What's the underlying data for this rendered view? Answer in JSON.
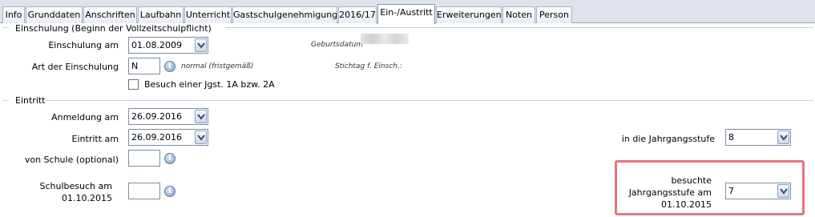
{
  "tabs": [
    {
      "label": "Info",
      "active": false
    },
    {
      "label": "Grunddaten",
      "active": false
    },
    {
      "label": "Anschriften",
      "active": false
    },
    {
      "label": "Laufbahn",
      "active": false
    },
    {
      "label": "Unterricht",
      "active": false
    },
    {
      "label": "Gastschulgenehmigung",
      "active": false
    },
    {
      "label": "2016/17",
      "active": false
    },
    {
      "label": "Ein-/Austritt",
      "active": true
    },
    {
      "label": "Erweiterungen",
      "active": false
    },
    {
      "label": "Noten",
      "active": false
    },
    {
      "label": "Person",
      "active": false
    }
  ],
  "einschulung": {
    "title": "Einschulung (Beginn der Vollzeitschulpflicht)",
    "date_label": "Einschulung am",
    "date_value": "01.08.2009",
    "art_label": "Art der Einschulung",
    "art_value": "N",
    "art_description": "normal (fristgemäß)",
    "geburtsdatum_label": "Geburtsdatum",
    "stichtag_label": "Stichtag f. Einsch.:",
    "checkbox_label": "Besuch einer Jgst. 1A bzw. 2A",
    "checkbox_checked": false
  },
  "eintritt": {
    "title": "Eintritt",
    "anmeldung_label": "Anmeldung am",
    "anmeldung_value": "26.09.2016",
    "eintritt_label": "Eintritt am",
    "eintritt_value": "26.09.2016",
    "von_schule_label": "von Schule (optional)",
    "von_schule_value": "",
    "schulbesuch_label_1": "Schulbesuch am",
    "schulbesuch_label_2": "01.10.2015",
    "schulbesuch_value": "",
    "jahrgangsstufe_label": "in die Jahrgangsstufe",
    "jahrgangsstufe_value": "8",
    "besuchte_label_1": "besuchte",
    "besuchte_label_2": "Jahrgangsstufe am",
    "besuchte_label_3": "01.10.2015",
    "besuchte_value": "7"
  },
  "colors": {
    "highlight": "#e0787c",
    "tab_border": "#a5b4c9",
    "section_line": "#c7d0dc"
  }
}
